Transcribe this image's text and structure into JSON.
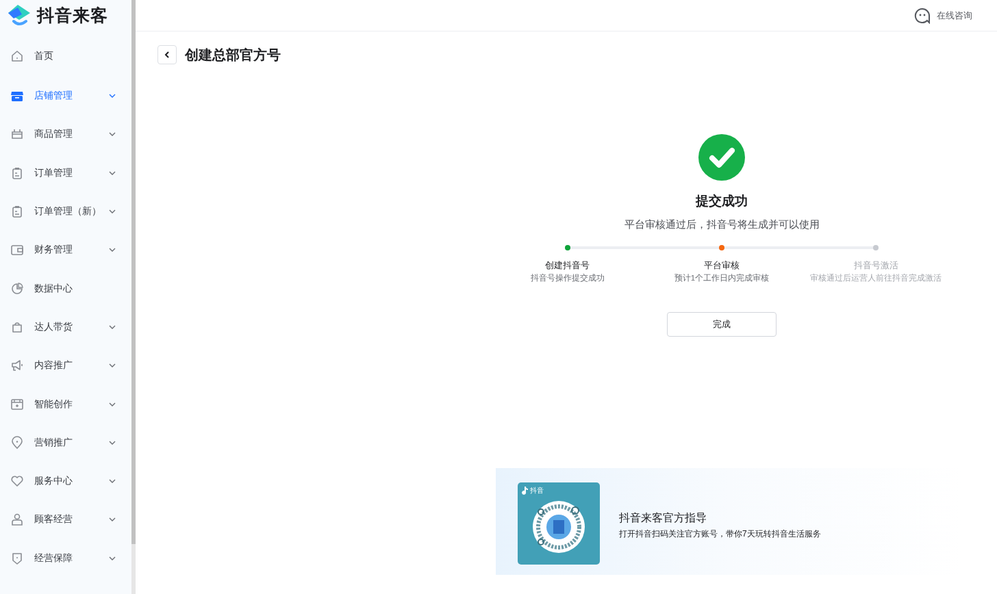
{
  "logo": {
    "text": "抖音来客"
  },
  "sidebar": {
    "items": [
      {
        "label": "首页",
        "expandable": false,
        "selected": false
      },
      {
        "label": "店铺管理",
        "expandable": true,
        "selected": true
      },
      {
        "label": "商品管理",
        "expandable": true,
        "selected": false
      },
      {
        "label": "订单管理",
        "expandable": true,
        "selected": false
      },
      {
        "label": "订单管理（新）",
        "expandable": true,
        "selected": false
      },
      {
        "label": "财务管理",
        "expandable": true,
        "selected": false
      },
      {
        "label": "数据中心",
        "expandable": false,
        "selected": false
      },
      {
        "label": "达人带货",
        "expandable": true,
        "selected": false
      },
      {
        "label": "内容推广",
        "expandable": true,
        "selected": false
      },
      {
        "label": "智能创作",
        "expandable": true,
        "selected": false
      },
      {
        "label": "营销推广",
        "expandable": true,
        "selected": false
      },
      {
        "label": "服务中心",
        "expandable": true,
        "selected": false
      },
      {
        "label": "顾客经营",
        "expandable": true,
        "selected": false
      },
      {
        "label": "经营保障",
        "expandable": true,
        "selected": false
      }
    ]
  },
  "header": {
    "consult": "在线咨询"
  },
  "page": {
    "title": "创建总部官方号"
  },
  "result": {
    "title": "提交成功",
    "message": "平台审核通过后，抖音号将生成并可以使用",
    "steps": [
      {
        "label": "创建抖音号",
        "description": "抖音号操作提交成功",
        "kind": "done"
      },
      {
        "label": "平台审核",
        "description": "预计1个工作日内完成审核",
        "kind": "current"
      },
      {
        "label": "抖音号激活",
        "description": "审核通过后运营人前往抖音完成激活",
        "kind": "pending"
      }
    ],
    "button": "完成"
  },
  "promo": {
    "qr_brand": "抖音",
    "title": "抖音来客官方指导",
    "text": "打开抖音扫码关注官方账号，带你7天玩转抖音生活服务"
  }
}
